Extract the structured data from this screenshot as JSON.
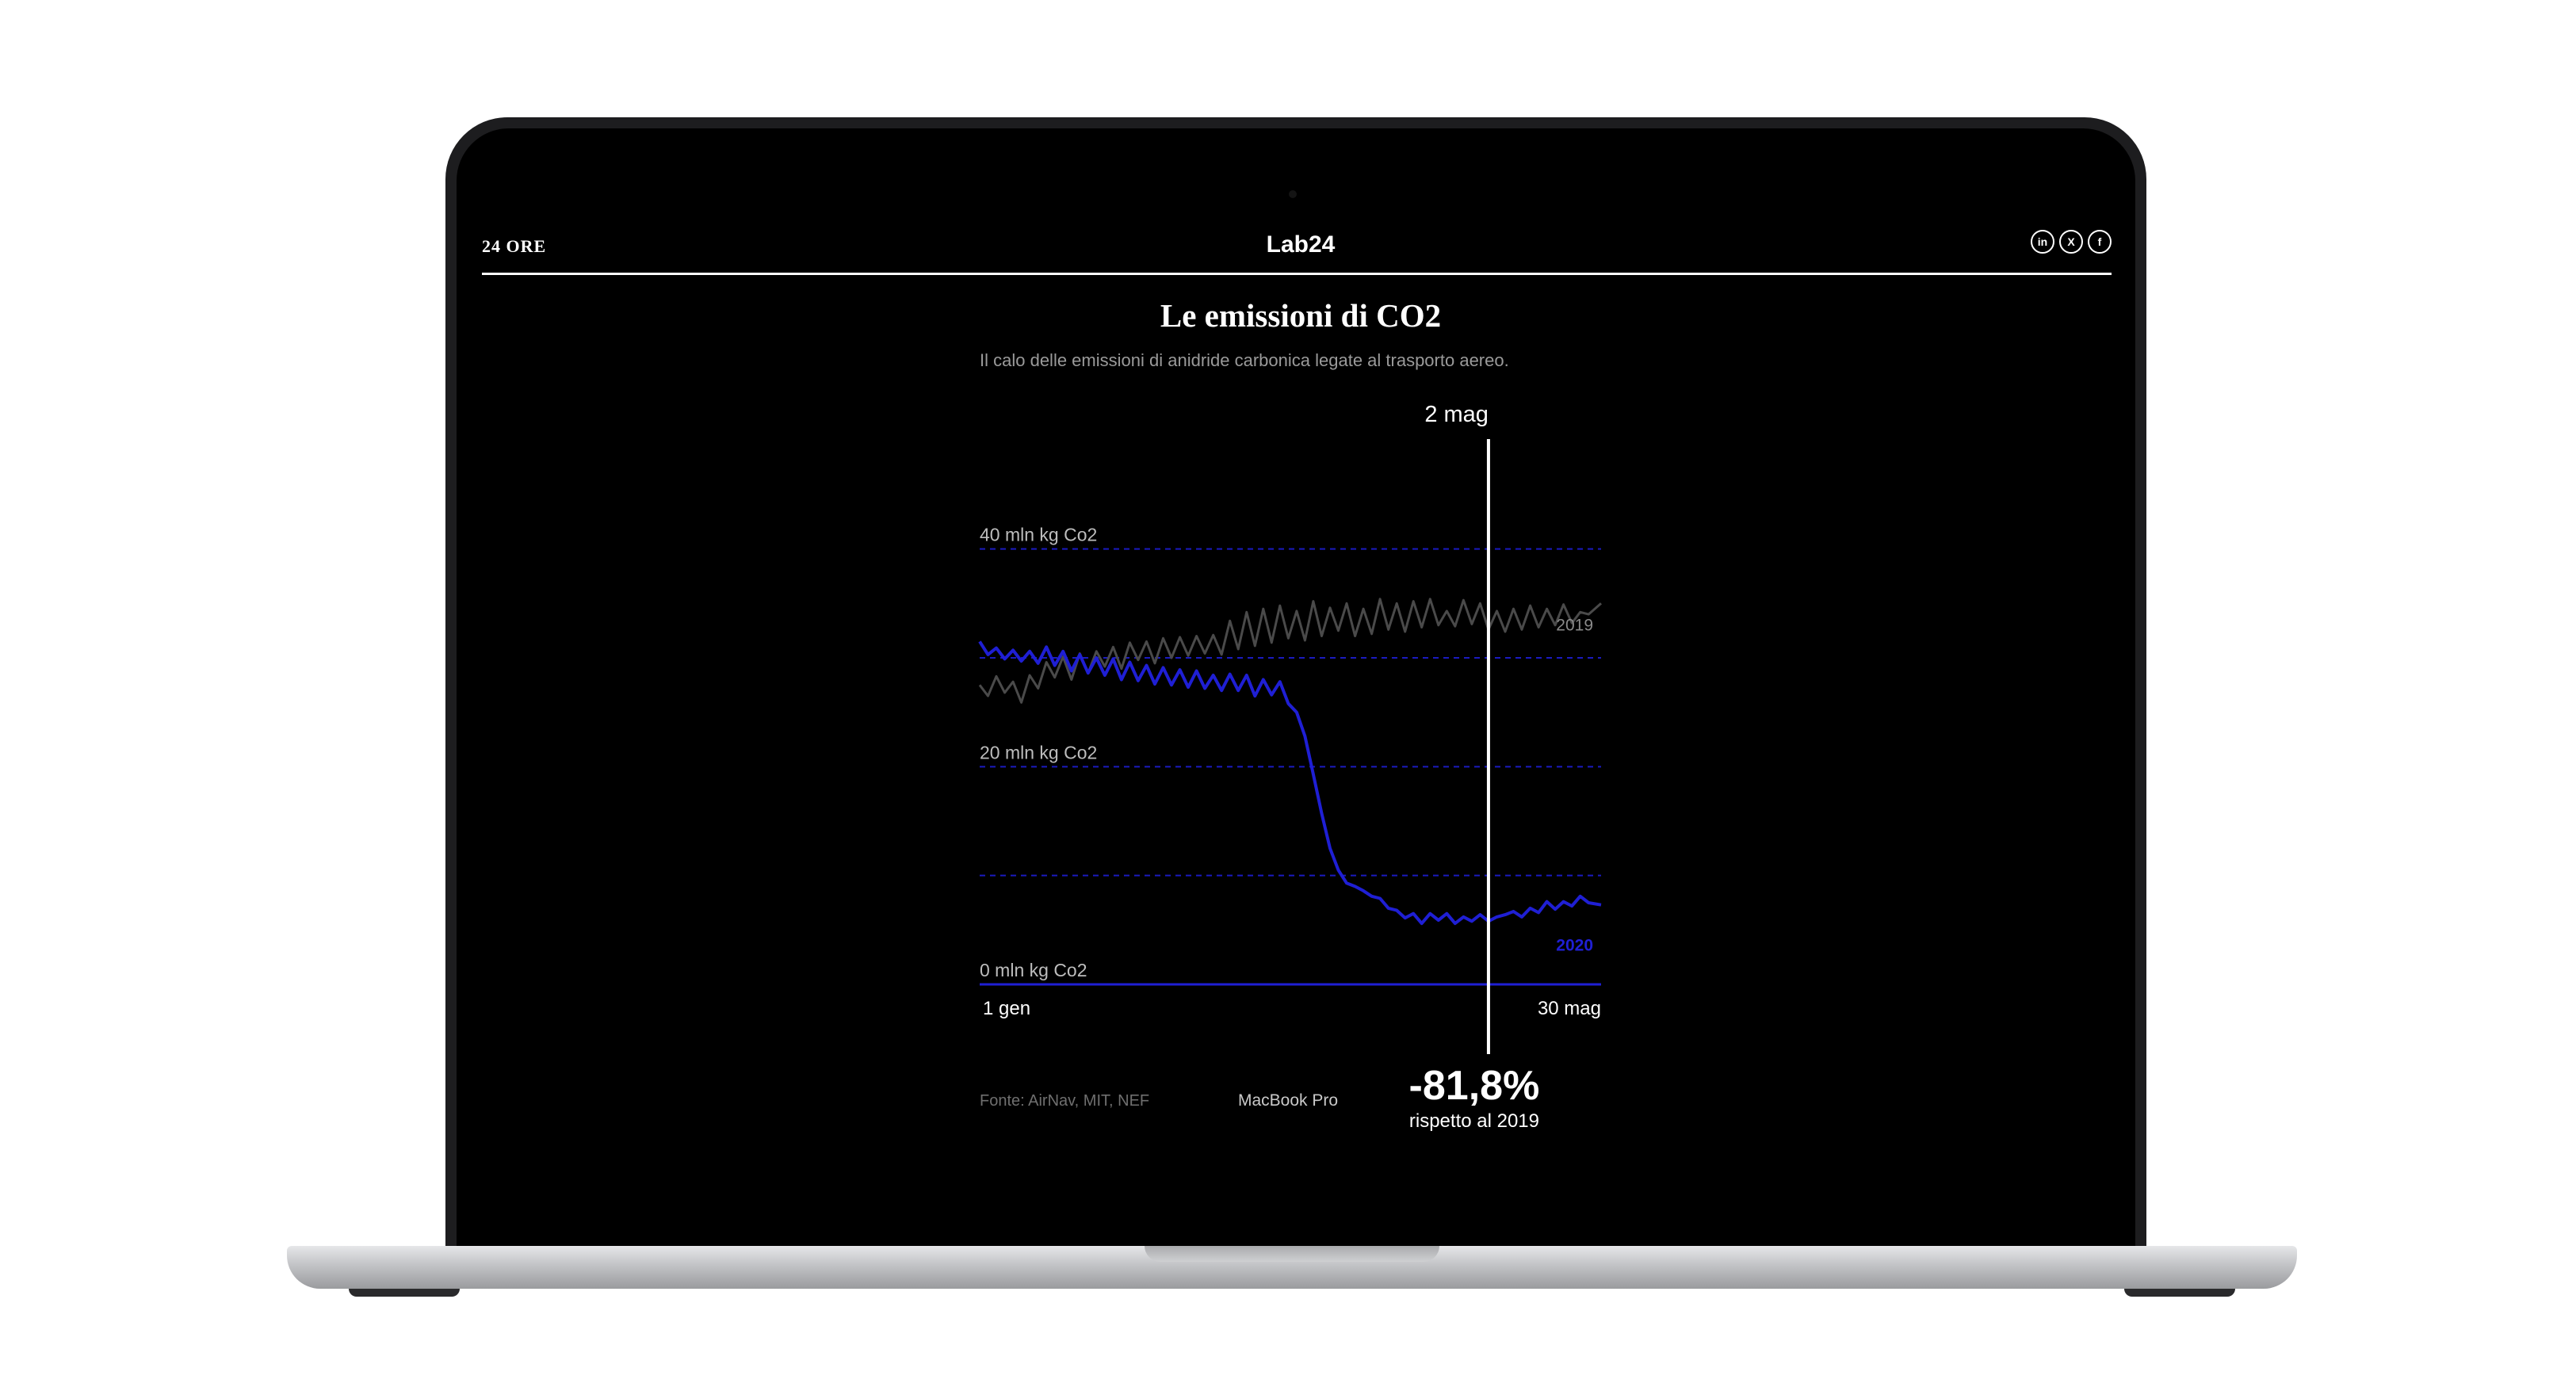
{
  "device": {
    "model_label": "MacBook Pro"
  },
  "header": {
    "logo": "24 ORE",
    "title": "Lab24",
    "social": [
      {
        "label": "in",
        "icon": "linkedin-icon"
      },
      {
        "label": "X",
        "icon": "x-icon"
      },
      {
        "label": "f",
        "icon": "facebook-icon"
      }
    ]
  },
  "chart_title": "Le emissioni di CO2",
  "chart_subtitle": "Il calo delle emissioni di anidride carbonica legate al trasporto aereo.",
  "source": "Fonte: AirNav, MIT, NEF",
  "colors": {
    "series_2019": "#4a4a4a",
    "series_2020": "#1f1fd4",
    "accent": "#ffffff",
    "grid": "#1f1fd4"
  },
  "chart_data": {
    "type": "line",
    "y_unit": "mln kg Co2",
    "ylim": [
      0,
      45
    ],
    "y_ticks": [
      {
        "value": 40,
        "label": "40 mln kg Co2"
      },
      {
        "value": 20,
        "label": "20 mln kg Co2"
      },
      {
        "value": 0,
        "label": "0 mln kg Co2"
      }
    ],
    "x_tick_labels": [
      "1 gen",
      "30 mag"
    ],
    "x_range": [
      1,
      150
    ],
    "grid": true,
    "series": [
      {
        "name": "2019",
        "x": [
          1,
          3,
          5,
          7,
          9,
          11,
          13,
          15,
          17,
          19,
          21,
          23,
          25,
          27,
          29,
          31,
          33,
          35,
          37,
          39,
          41,
          43,
          45,
          47,
          49,
          51,
          53,
          55,
          57,
          59,
          61,
          63,
          65,
          67,
          69,
          71,
          73,
          75,
          77,
          79,
          81,
          83,
          85,
          87,
          89,
          91,
          93,
          95,
          97,
          99,
          101,
          103,
          105,
          107,
          109,
          111,
          113,
          115,
          117,
          119,
          121,
          123,
          125,
          127,
          129,
          131,
          133,
          135,
          137,
          139,
          141,
          143,
          145,
          147,
          150
        ],
        "values": [
          27.5,
          26.5,
          28.3,
          26.8,
          27.8,
          25.9,
          28.4,
          27.2,
          29.6,
          28.2,
          30.1,
          28.0,
          30.4,
          28.6,
          30.6,
          29.2,
          31.0,
          29.0,
          31.4,
          29.8,
          31.5,
          29.5,
          31.8,
          30.0,
          31.9,
          30.2,
          32.0,
          30.4,
          32.1,
          30.3,
          33.4,
          30.8,
          34.2,
          31.1,
          34.5,
          31.4,
          34.8,
          31.8,
          34.3,
          31.6,
          35.2,
          32.0,
          34.6,
          32.5,
          35.0,
          32.0,
          34.5,
          32.2,
          35.4,
          32.6,
          35.0,
          32.4,
          35.2,
          32.8,
          35.4,
          33.0,
          34.3,
          32.9,
          35.3,
          33.1,
          35.0,
          32.6,
          34.3,
          32.4,
          34.5,
          32.6,
          34.8,
          32.8,
          34.5,
          33.0,
          34.9,
          33.2,
          34.2,
          34.0,
          35.0
        ]
      },
      {
        "name": "2020",
        "x": [
          1,
          3,
          5,
          7,
          9,
          11,
          13,
          15,
          17,
          19,
          21,
          23,
          25,
          27,
          29,
          31,
          33,
          35,
          37,
          39,
          41,
          43,
          45,
          47,
          49,
          51,
          53,
          55,
          57,
          59,
          61,
          63,
          65,
          67,
          69,
          71,
          73,
          75,
          77,
          79,
          81,
          83,
          85,
          87,
          89,
          91,
          93,
          95,
          97,
          99,
          101,
          103,
          105,
          107,
          109,
          111,
          113,
          115,
          117,
          119,
          121,
          123,
          125,
          127,
          129,
          131,
          133,
          135,
          137,
          139,
          141,
          143,
          145,
          147,
          150
        ],
        "values": [
          31.5,
          30.3,
          30.9,
          29.9,
          30.7,
          29.7,
          30.6,
          29.5,
          31.0,
          29.3,
          30.6,
          28.8,
          30.3,
          28.6,
          30.0,
          28.4,
          29.9,
          28.0,
          29.6,
          27.9,
          29.3,
          27.6,
          29.1,
          27.5,
          28.9,
          27.3,
          28.8,
          27.2,
          28.4,
          27.0,
          28.5,
          27.0,
          28.4,
          26.5,
          28.0,
          26.6,
          27.8,
          25.8,
          25.0,
          22.8,
          19.3,
          15.7,
          12.5,
          10.5,
          9.3,
          9.0,
          8.6,
          8.1,
          7.9,
          7.0,
          6.8,
          6.1,
          6.5,
          5.6,
          6.5,
          5.9,
          6.5,
          5.6,
          6.2,
          5.8,
          6.4,
          5.8,
          6.2,
          6.4,
          6.7,
          6.2,
          7.0,
          6.6,
          7.6,
          6.9,
          7.6,
          7.2,
          8.1,
          7.5,
          7.3
        ]
      }
    ],
    "series_labels": [
      {
        "series": "2019",
        "text": "2019"
      },
      {
        "series": "2020",
        "text": "2020"
      }
    ],
    "marker": {
      "x": 123,
      "date_label": "2 mag",
      "value_label": "-81,8%",
      "sub_label": "rispetto al 2019"
    }
  }
}
